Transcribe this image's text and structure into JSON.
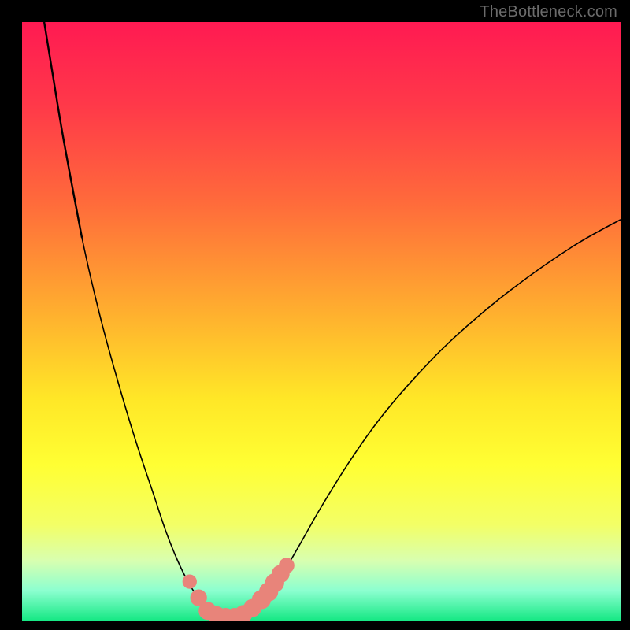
{
  "watermark": "TheBottleneck.com",
  "colors": {
    "frame": "#000000",
    "gradient_stops": [
      {
        "pct": 0,
        "color": "#ff1a52"
      },
      {
        "pct": 14,
        "color": "#ff3949"
      },
      {
        "pct": 30,
        "color": "#ff6a3b"
      },
      {
        "pct": 48,
        "color": "#ffad2f"
      },
      {
        "pct": 63,
        "color": "#ffe727"
      },
      {
        "pct": 74,
        "color": "#ffff33"
      },
      {
        "pct": 84,
        "color": "#f3ff66"
      },
      {
        "pct": 90,
        "color": "#d8ffb0"
      },
      {
        "pct": 95,
        "color": "#8cffd0"
      },
      {
        "pct": 100,
        "color": "#16e884"
      }
    ],
    "curve": "#000000",
    "marker": "#e8847a"
  },
  "chart_data": {
    "type": "line",
    "title": "",
    "xlabel": "",
    "ylabel": "",
    "xlim": [
      0,
      100
    ],
    "ylim": [
      0,
      100
    ],
    "grid": false,
    "legend": false,
    "series": [
      {
        "name": "bottleneck-curve",
        "x": [
          3.7,
          5,
          7,
          10,
          13,
          16,
          19,
          22,
          24,
          26,
          28,
          30,
          31.5,
          33,
          35.5,
          38,
          40,
          43,
          46,
          50,
          55,
          60,
          66,
          73,
          82,
          92,
          100
        ],
        "values": [
          100,
          92,
          80,
          64,
          51,
          40,
          30,
          21,
          15,
          10,
          6,
          3,
          1.2,
          0.6,
          0.6,
          1.6,
          3.5,
          7,
          12,
          19,
          27,
          34,
          41,
          48,
          55.5,
          62.5,
          67
        ]
      }
    ],
    "markers": [
      {
        "x": 28.0,
        "y": 6.5,
        "r": 1.2
      },
      {
        "x": 29.5,
        "y": 3.8,
        "r": 1.4
      },
      {
        "x": 31.0,
        "y": 1.6,
        "r": 1.5
      },
      {
        "x": 32.5,
        "y": 0.9,
        "r": 1.5
      },
      {
        "x": 34.0,
        "y": 0.6,
        "r": 1.5
      },
      {
        "x": 35.5,
        "y": 0.6,
        "r": 1.5
      },
      {
        "x": 37.0,
        "y": 1.1,
        "r": 1.5
      },
      {
        "x": 38.5,
        "y": 2.1,
        "r": 1.5
      },
      {
        "x": 40.0,
        "y": 3.5,
        "r": 1.6
      },
      {
        "x": 41.2,
        "y": 4.8,
        "r": 1.6
      },
      {
        "x": 42.2,
        "y": 6.3,
        "r": 1.6
      },
      {
        "x": 43.2,
        "y": 7.8,
        "r": 1.5
      },
      {
        "x": 44.2,
        "y": 9.2,
        "r": 1.3
      }
    ]
  }
}
